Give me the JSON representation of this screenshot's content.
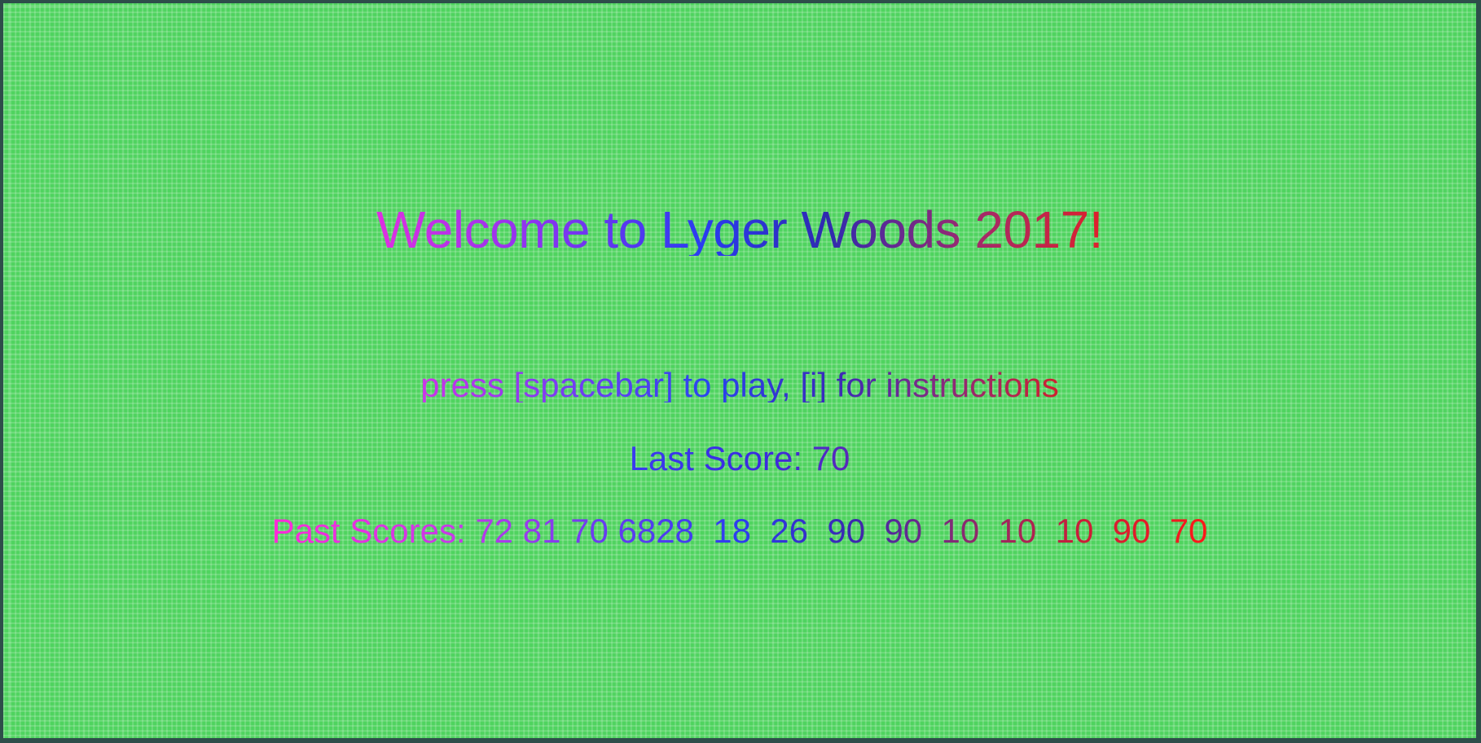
{
  "title": "Welcome to Lyger Woods 2017!",
  "prompt": "press [spacebar] to play, [i] for instructions",
  "last_score_text": "Last Score: 70",
  "past_scores_text": "Past Scores: 72 81 70 6828  18  26  90  90  10  10  10  90  70",
  "colors": {
    "background": "#4fd35f",
    "frame_border": "#2e4d4a",
    "gradient_start": "#e02fe0",
    "gradient_mid": "#2a3cf0",
    "gradient_end": "#e0202a"
  }
}
